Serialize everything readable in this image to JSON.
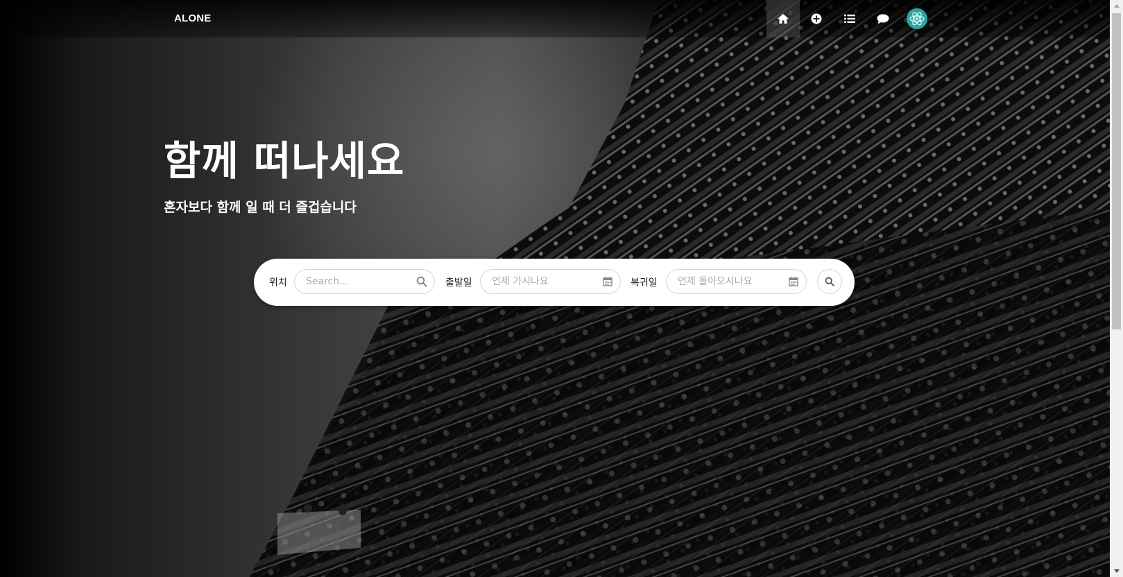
{
  "nav": {
    "brand": "ALONE",
    "icons": [
      "home-icon",
      "plus-circle-icon",
      "list-icon",
      "chat-icon",
      "avatar-icon"
    ]
  },
  "hero": {
    "title": "함께 떠나세요",
    "subtitle": "혼자보다 함께 일 때 더 즐겁습니다"
  },
  "search": {
    "location_label": "위치",
    "location_placeholder": "Search...",
    "depart_label": "출발일",
    "depart_placeholder": "언제 가시나요",
    "return_label": "복귀일",
    "return_placeholder": "언제 돌아오시나요"
  },
  "colors": {
    "avatar_bg": "#2fa3a3",
    "search_bg": "#ffffff"
  }
}
